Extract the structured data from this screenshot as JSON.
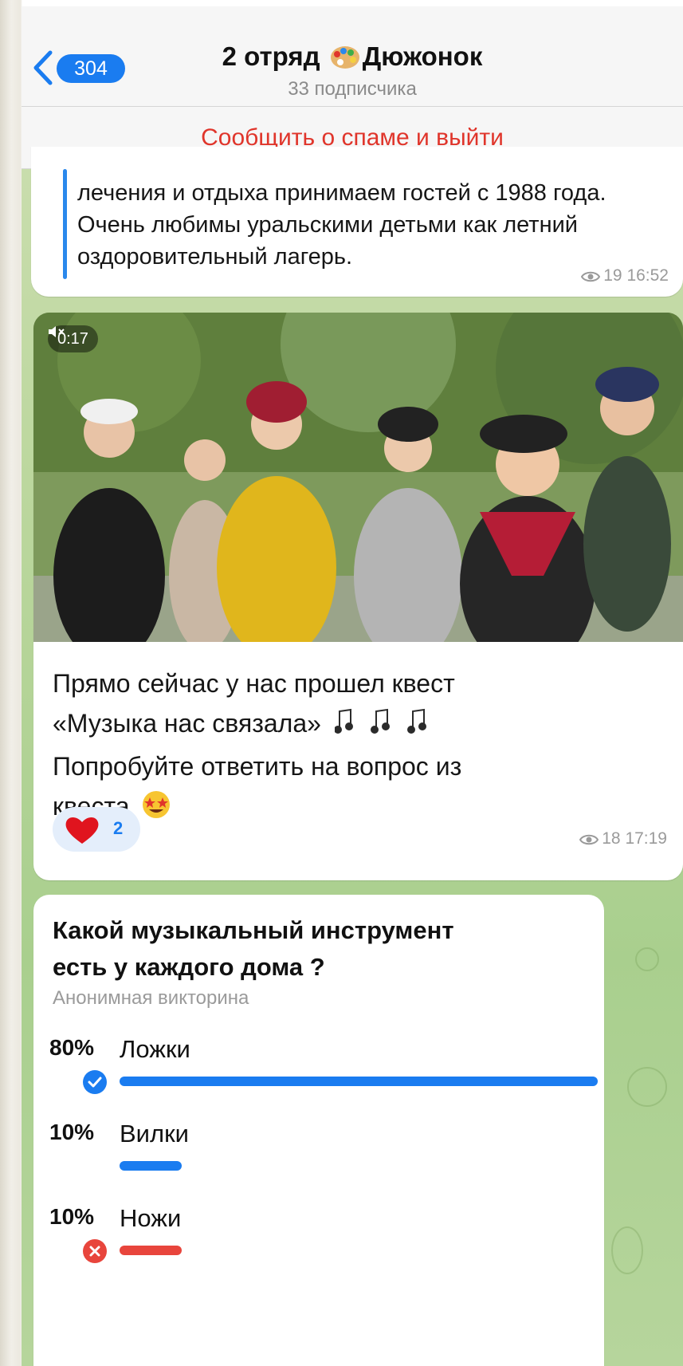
{
  "header": {
    "back_count": "304",
    "title_part1": "2 отряд",
    "title_part2": "Дюжонок",
    "title_emoji": "palette-icon",
    "subtitle": "33 подписчика"
  },
  "spam_bar": {
    "label": "Сообщить о спаме и выйти"
  },
  "messages": [
    {
      "text": "лечения и отдыха принимаем гостей с 1988 года. Очень любимы уральскими детьми как летний оздоровительный лагерь.",
      "views": "19",
      "time": "16:52"
    },
    {
      "video_time": "0:17",
      "video_muted_icon": "speaker-muted-icon",
      "text_line1": "Прямо сейчас у нас прошел квест",
      "text_line2": "«Музыка нас связала»",
      "text_line2_emoji": "musical-notes-icon",
      "text_line3": "Попробуйте ответить на вопрос из",
      "text_line4": "квеста",
      "text_line4_emoji": "star-struck-icon",
      "reaction_emoji": "heart-icon",
      "reaction_count": "2",
      "views": "18",
      "time": "17:19"
    }
  ],
  "poll": {
    "question_line1": "Какой музыкальный инструмент",
    "question_line2": "есть у каждого дома ?",
    "type_label": "Анонимная викторина",
    "options": [
      {
        "percent_label": "80%",
        "label": "Ложки",
        "fraction": 0.8,
        "status": "correct",
        "bar_color": "#1a7cf0"
      },
      {
        "percent_label": "10%",
        "label": "Вилки",
        "fraction": 0.1,
        "status": "none",
        "bar_color": "#1a7cf0"
      },
      {
        "percent_label": "10%",
        "label": "Ножи",
        "fraction": 0.1,
        "status": "wrong",
        "bar_color": "#e8453c"
      }
    ]
  },
  "colors": {
    "accent": "#1a7cf0",
    "spam": "#e0352b",
    "wrong": "#e8453c"
  }
}
